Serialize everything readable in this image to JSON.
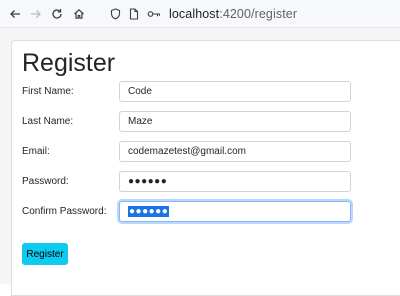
{
  "browser": {
    "address_host": "localhost",
    "address_path": ":4200/register"
  },
  "form": {
    "title": "Register",
    "fields": [
      {
        "label": "First Name:",
        "value": "Code"
      },
      {
        "label": "Last Name:",
        "value": "Maze"
      },
      {
        "label": "Email:",
        "value": "codemazetest@gmail.com"
      },
      {
        "label": "Password:",
        "value": "●●●●●●"
      },
      {
        "label": "Confirm Password:",
        "value": "●●●●●●"
      }
    ],
    "submit_label": "Register"
  },
  "colors": {
    "accent": "#0dcaf0",
    "focus_ring": "#86b7fe",
    "selection": "#1a73e8"
  },
  "icons": [
    "back-arrow-icon",
    "forward-arrow-icon",
    "reload-icon",
    "home-icon",
    "shield-icon",
    "page-icon",
    "key-icon"
  ]
}
